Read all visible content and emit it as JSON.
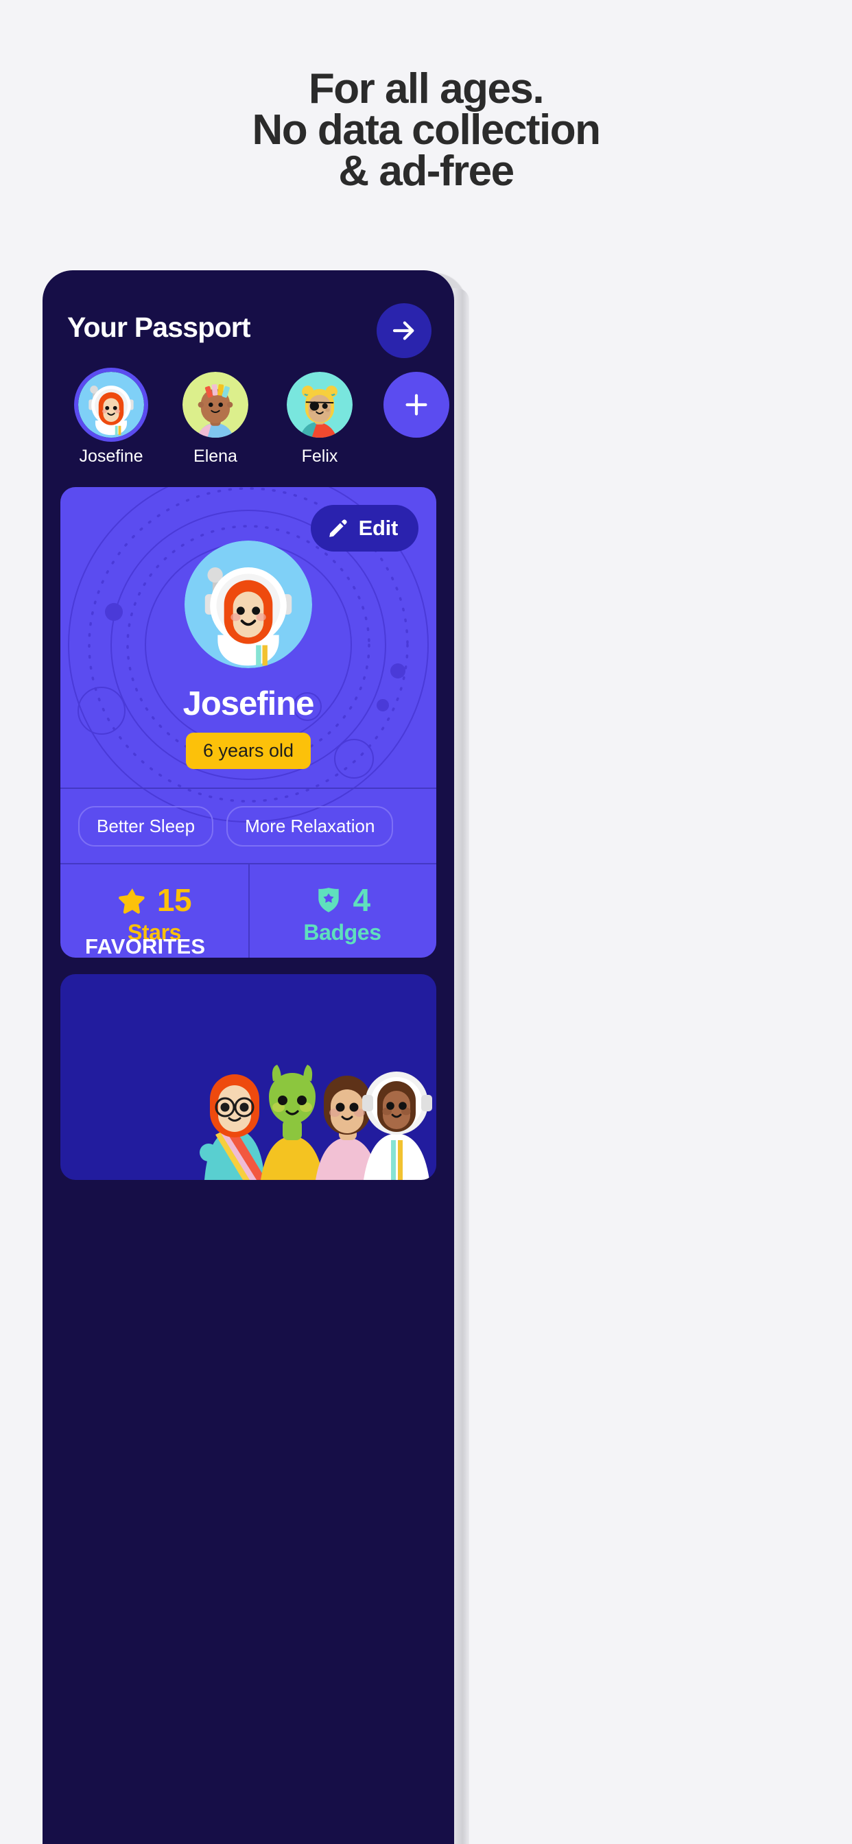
{
  "marketing": {
    "headline_lines": [
      "For all ages.",
      "No data collection",
      "& ad-free"
    ]
  },
  "colors": {
    "page_background": "#f4f4f7",
    "headline_text": "#2b2b2b",
    "phone_background": "#160e47",
    "accent_purple": "#5b4cf0",
    "deep_purple": "#2a24ad",
    "card_purple": "#5b4cf0",
    "bottom_card": "#221c9e",
    "gold": "#fcc10a",
    "mint": "#5fe0bd",
    "white": "#ffffff"
  },
  "app": {
    "header": {
      "title": "Your Passport",
      "forward_icon": "arrow-right-icon"
    },
    "profiles": [
      {
        "name": "Josefine",
        "avatar": "astronaut-redhead-avatar",
        "selected": true
      },
      {
        "name": "Elena",
        "avatar": "rainbow-hair-avatar",
        "selected": false
      },
      {
        "name": "Felix",
        "avatar": "blonde-sunglasses-avatar",
        "selected": false
      }
    ],
    "add_profile": {
      "icon": "plus-icon",
      "label": "+"
    },
    "profile_card": {
      "edit_button": {
        "label": "Edit",
        "icon": "pencil-icon"
      },
      "avatar": "astronaut-redhead-avatar",
      "name": "Josefine",
      "age": "6 years old",
      "tags": [
        "Better Sleep",
        "More Relaxation"
      ],
      "stats": [
        {
          "icon": "star-icon",
          "value": "15",
          "label": "Stars",
          "color": "#fcc10a"
        },
        {
          "icon": "shield-star-icon",
          "value": "4",
          "label": "Badges",
          "color": "#5fe0bd"
        }
      ],
      "favorites_label": "FAVORITES"
    },
    "bottom_card": {
      "illustration": "group-of-characters-illustration"
    }
  }
}
